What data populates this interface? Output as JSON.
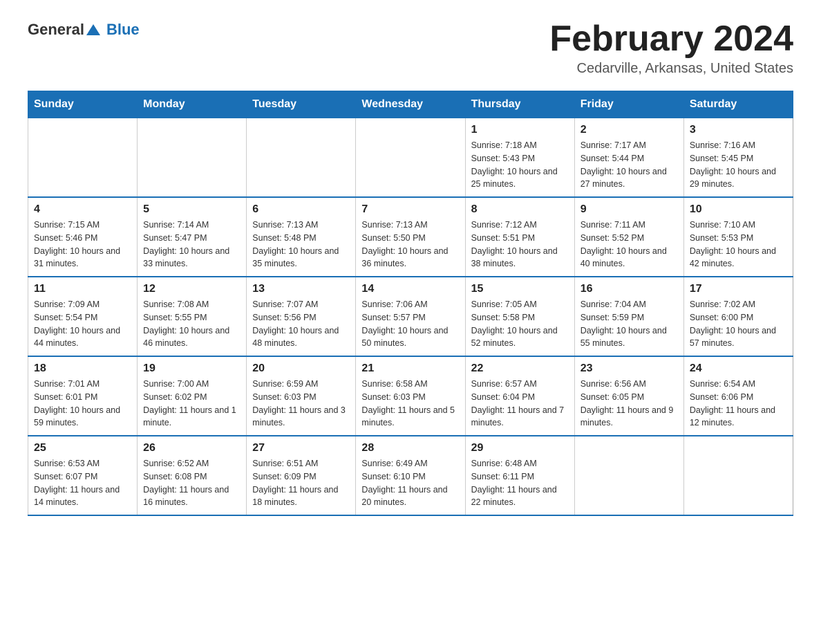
{
  "header": {
    "logo_general": "General",
    "logo_blue": "Blue",
    "month_year": "February 2024",
    "location": "Cedarville, Arkansas, United States"
  },
  "days_of_week": [
    "Sunday",
    "Monday",
    "Tuesday",
    "Wednesday",
    "Thursday",
    "Friday",
    "Saturday"
  ],
  "weeks": [
    [
      {
        "day": "",
        "info": ""
      },
      {
        "day": "",
        "info": ""
      },
      {
        "day": "",
        "info": ""
      },
      {
        "day": "",
        "info": ""
      },
      {
        "day": "1",
        "info": "Sunrise: 7:18 AM\nSunset: 5:43 PM\nDaylight: 10 hours and 25 minutes."
      },
      {
        "day": "2",
        "info": "Sunrise: 7:17 AM\nSunset: 5:44 PM\nDaylight: 10 hours and 27 minutes."
      },
      {
        "day": "3",
        "info": "Sunrise: 7:16 AM\nSunset: 5:45 PM\nDaylight: 10 hours and 29 minutes."
      }
    ],
    [
      {
        "day": "4",
        "info": "Sunrise: 7:15 AM\nSunset: 5:46 PM\nDaylight: 10 hours and 31 minutes."
      },
      {
        "day": "5",
        "info": "Sunrise: 7:14 AM\nSunset: 5:47 PM\nDaylight: 10 hours and 33 minutes."
      },
      {
        "day": "6",
        "info": "Sunrise: 7:13 AM\nSunset: 5:48 PM\nDaylight: 10 hours and 35 minutes."
      },
      {
        "day": "7",
        "info": "Sunrise: 7:13 AM\nSunset: 5:50 PM\nDaylight: 10 hours and 36 minutes."
      },
      {
        "day": "8",
        "info": "Sunrise: 7:12 AM\nSunset: 5:51 PM\nDaylight: 10 hours and 38 minutes."
      },
      {
        "day": "9",
        "info": "Sunrise: 7:11 AM\nSunset: 5:52 PM\nDaylight: 10 hours and 40 minutes."
      },
      {
        "day": "10",
        "info": "Sunrise: 7:10 AM\nSunset: 5:53 PM\nDaylight: 10 hours and 42 minutes."
      }
    ],
    [
      {
        "day": "11",
        "info": "Sunrise: 7:09 AM\nSunset: 5:54 PM\nDaylight: 10 hours and 44 minutes."
      },
      {
        "day": "12",
        "info": "Sunrise: 7:08 AM\nSunset: 5:55 PM\nDaylight: 10 hours and 46 minutes."
      },
      {
        "day": "13",
        "info": "Sunrise: 7:07 AM\nSunset: 5:56 PM\nDaylight: 10 hours and 48 minutes."
      },
      {
        "day": "14",
        "info": "Sunrise: 7:06 AM\nSunset: 5:57 PM\nDaylight: 10 hours and 50 minutes."
      },
      {
        "day": "15",
        "info": "Sunrise: 7:05 AM\nSunset: 5:58 PM\nDaylight: 10 hours and 52 minutes."
      },
      {
        "day": "16",
        "info": "Sunrise: 7:04 AM\nSunset: 5:59 PM\nDaylight: 10 hours and 55 minutes."
      },
      {
        "day": "17",
        "info": "Sunrise: 7:02 AM\nSunset: 6:00 PM\nDaylight: 10 hours and 57 minutes."
      }
    ],
    [
      {
        "day": "18",
        "info": "Sunrise: 7:01 AM\nSunset: 6:01 PM\nDaylight: 10 hours and 59 minutes."
      },
      {
        "day": "19",
        "info": "Sunrise: 7:00 AM\nSunset: 6:02 PM\nDaylight: 11 hours and 1 minute."
      },
      {
        "day": "20",
        "info": "Sunrise: 6:59 AM\nSunset: 6:03 PM\nDaylight: 11 hours and 3 minutes."
      },
      {
        "day": "21",
        "info": "Sunrise: 6:58 AM\nSunset: 6:03 PM\nDaylight: 11 hours and 5 minutes."
      },
      {
        "day": "22",
        "info": "Sunrise: 6:57 AM\nSunset: 6:04 PM\nDaylight: 11 hours and 7 minutes."
      },
      {
        "day": "23",
        "info": "Sunrise: 6:56 AM\nSunset: 6:05 PM\nDaylight: 11 hours and 9 minutes."
      },
      {
        "day": "24",
        "info": "Sunrise: 6:54 AM\nSunset: 6:06 PM\nDaylight: 11 hours and 12 minutes."
      }
    ],
    [
      {
        "day": "25",
        "info": "Sunrise: 6:53 AM\nSunset: 6:07 PM\nDaylight: 11 hours and 14 minutes."
      },
      {
        "day": "26",
        "info": "Sunrise: 6:52 AM\nSunset: 6:08 PM\nDaylight: 11 hours and 16 minutes."
      },
      {
        "day": "27",
        "info": "Sunrise: 6:51 AM\nSunset: 6:09 PM\nDaylight: 11 hours and 18 minutes."
      },
      {
        "day": "28",
        "info": "Sunrise: 6:49 AM\nSunset: 6:10 PM\nDaylight: 11 hours and 20 minutes."
      },
      {
        "day": "29",
        "info": "Sunrise: 6:48 AM\nSunset: 6:11 PM\nDaylight: 11 hours and 22 minutes."
      },
      {
        "day": "",
        "info": ""
      },
      {
        "day": "",
        "info": ""
      }
    ]
  ]
}
